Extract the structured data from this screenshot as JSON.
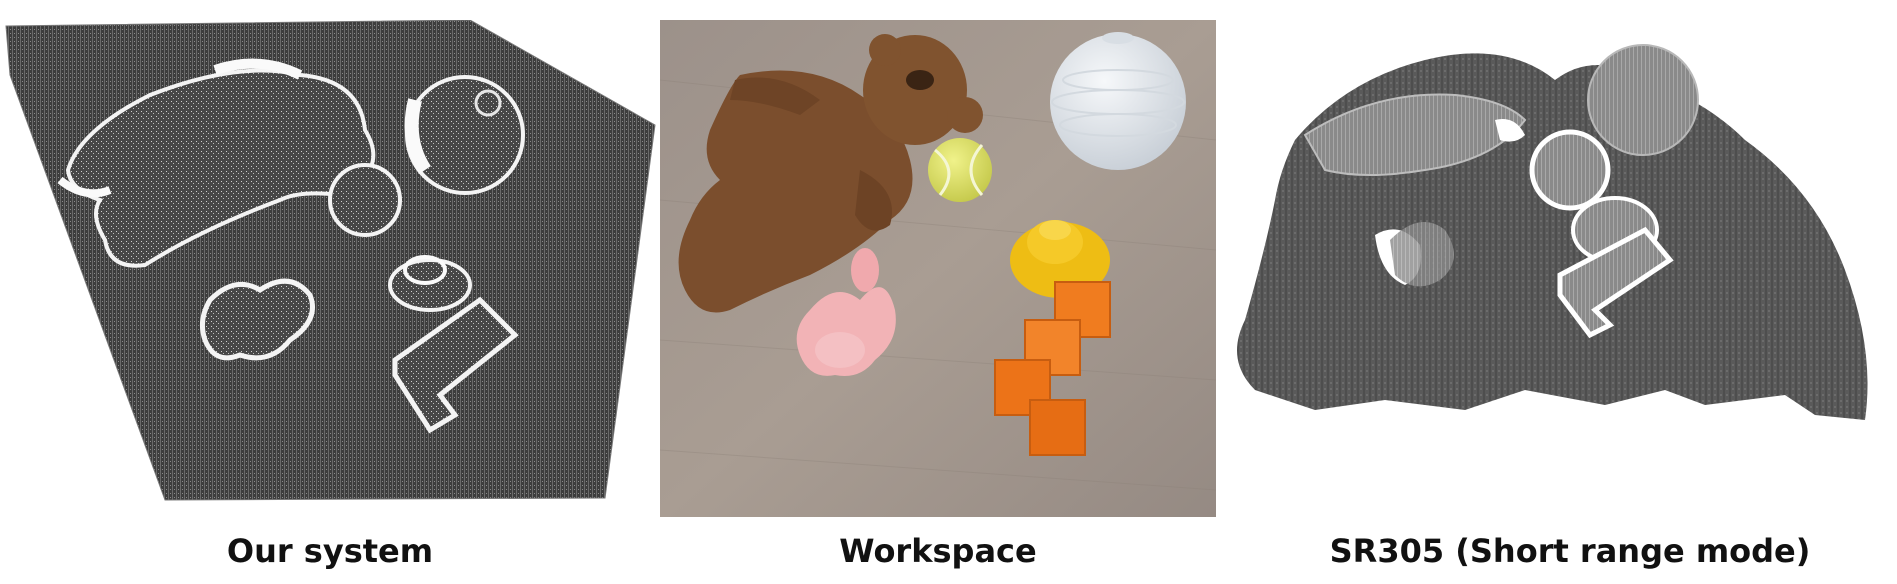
{
  "figure": {
    "panels": [
      {
        "id": "our-system",
        "caption": "Our system",
        "kind": "point-cloud"
      },
      {
        "id": "workspace",
        "caption": "Workspace",
        "kind": "photo"
      },
      {
        "id": "sr305",
        "caption": "SR305 (Short range mode)",
        "kind": "point-cloud"
      }
    ]
  },
  "colors": {
    "cloud_dark": "#3f3f3f",
    "cloud_light": "#eeeeee",
    "table_wood": "#9a8e86",
    "bear_brown": "#7a4e2c",
    "vase_white": "#e4e9ee",
    "ball_yellow": "#dfe36a",
    "duck_yellow": "#f0c21a",
    "block_orange": "#f07a1c",
    "toy_pink": "#f3b4b8",
    "sr305_gray": "#5a5a5a"
  }
}
